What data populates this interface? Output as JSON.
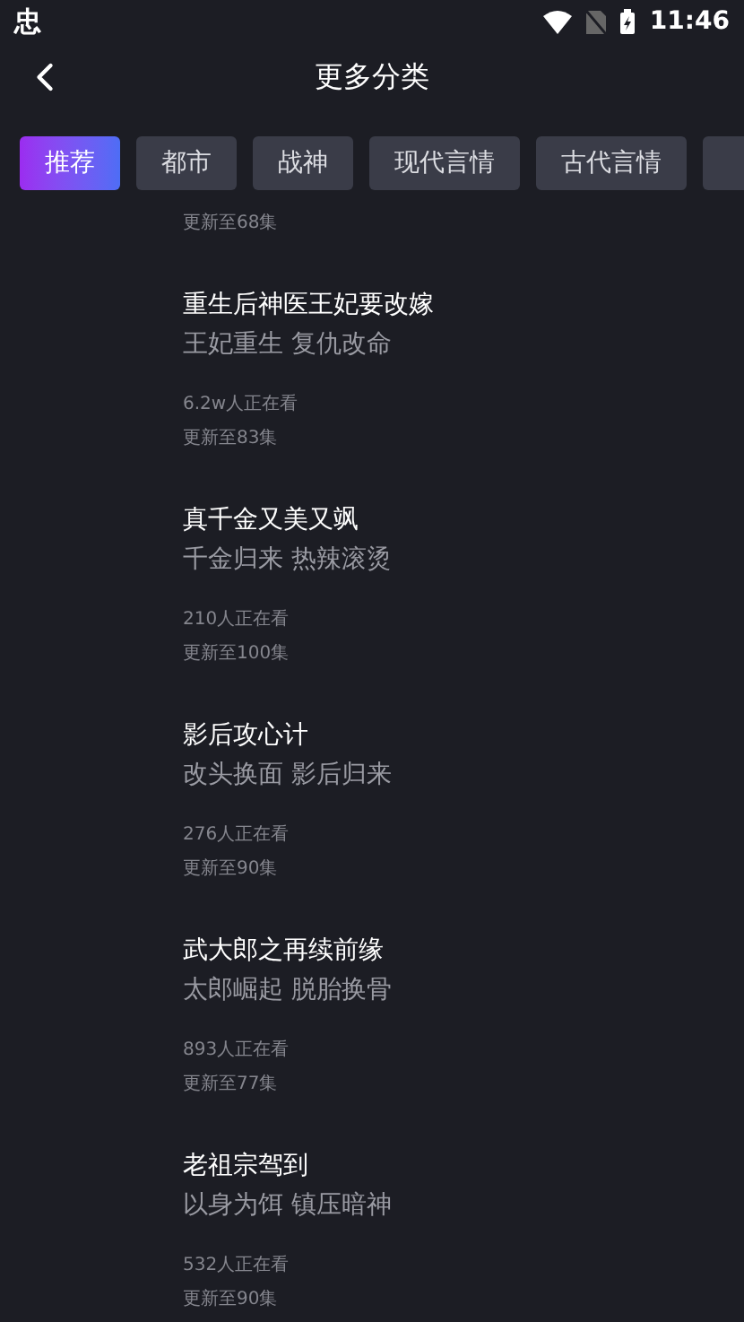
{
  "status_bar": {
    "app_glyph": "忠",
    "time": "11:46"
  },
  "header": {
    "title": "更多分类"
  },
  "tabs": [
    {
      "label": "推荐",
      "selected": true
    },
    {
      "label": "都市",
      "selected": false
    },
    {
      "label": "战神",
      "selected": false
    },
    {
      "label": "现代言情",
      "selected": false
    },
    {
      "label": "古代言情",
      "selected": false
    }
  ],
  "items": [
    {
      "update": "更新至68集"
    },
    {
      "title": "重生后神医王妃要改嫁",
      "tags": "王妃重生 复仇改命",
      "viewers": "6.2w人正在看",
      "update": "更新至83集"
    },
    {
      "title": "真千金又美又飒",
      "tags": "千金归来 热辣滚烫",
      "viewers": "210人正在看",
      "update": "更新至100集"
    },
    {
      "title": "影后攻心计",
      "tags": "改头换面 影后归来",
      "viewers": "276人正在看",
      "update": "更新至90集"
    },
    {
      "title": "武大郎之再续前缘",
      "tags": "太郎崛起 脱胎换骨",
      "viewers": "893人正在看",
      "update": "更新至77集"
    },
    {
      "title": "老祖宗驾到",
      "tags": "以身为饵 镇压暗神",
      "viewers": "532人正在看",
      "update": "更新至90集"
    }
  ]
}
